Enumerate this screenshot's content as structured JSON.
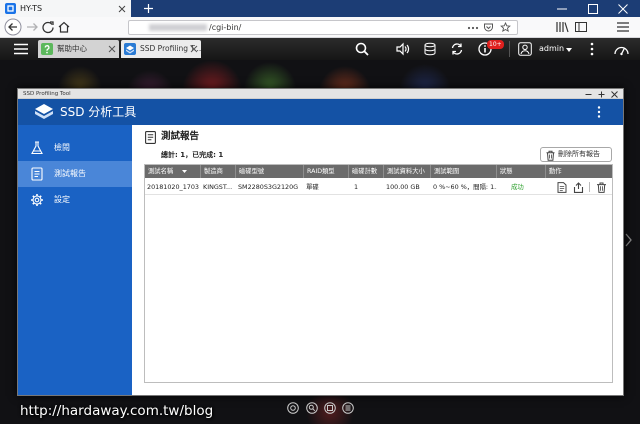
{
  "browser": {
    "tab_title": "HY-TS",
    "url_path": "/cgi-bin/"
  },
  "qts": {
    "tabs": [
      {
        "label": "幫助中心",
        "icon": "help-center-icon",
        "active": false
      },
      {
        "label": "SSD Profiling T...",
        "icon": "ssd-profiling-icon",
        "active": true
      }
    ],
    "notification_badge": "10+",
    "user": "admin"
  },
  "window": {
    "title": "SSD Profiling Tool",
    "app_title": "SSD 分析工具"
  },
  "sidebar": {
    "items": [
      {
        "label": "檢閱",
        "icon": "flask-icon",
        "selected": false
      },
      {
        "label": "測試報告",
        "icon": "report-icon",
        "selected": true
      },
      {
        "label": "設定",
        "icon": "gear-icon",
        "selected": false
      }
    ]
  },
  "main": {
    "title": "測試報告",
    "summary": "總計: 1，已完成: 1",
    "delete_all_label": "刪除所有報告",
    "table": {
      "columns": [
        "測試名稱",
        "製造商",
        "磁碟型號",
        "RAID類型",
        "磁碟計數",
        "測試資料大小",
        "測試範圍",
        "狀態",
        "動作"
      ],
      "rows": [
        {
          "name": "20181020_1703",
          "manufacturer": "KINGST...",
          "model": "SM2280S3G2120G",
          "raid": "單碟",
          "disk_count": "1",
          "data_size": "100.00 GB",
          "range": "0 %~60 %，間隔: 1...",
          "status": "成功",
          "actions": [
            "view-report-icon",
            "export-icon",
            "delete-icon"
          ]
        }
      ]
    }
  },
  "watermark": "http://hardaway.com.tw/blog",
  "colors": {
    "browser_titlebar": "#1c3d75",
    "app_header_blue": "#1452a5",
    "sidebar_blue": "#1a62c4",
    "sidebar_selected": "#4a86d8",
    "table_header_gray": "#6b6b6b",
    "status_success": "#2ea02e",
    "badge_red": "#e0201e"
  }
}
